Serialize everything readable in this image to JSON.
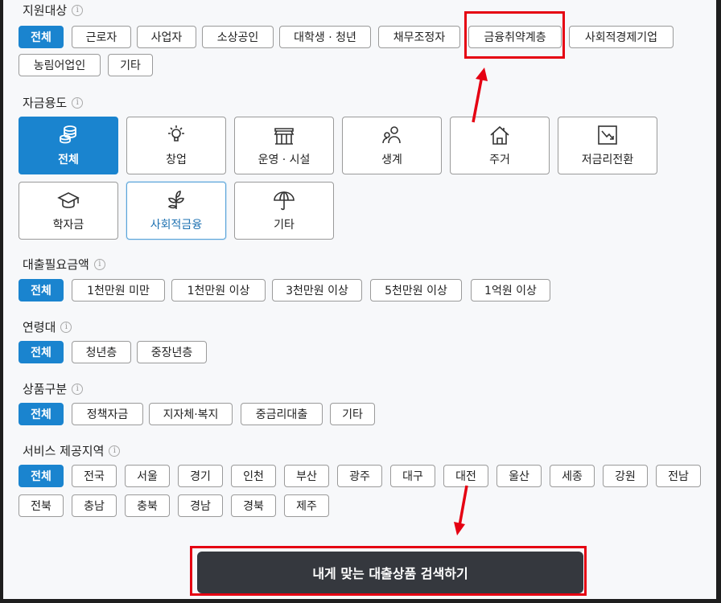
{
  "target_section": {
    "title": "지원대상",
    "row1": [
      "전체",
      "근로자",
      "사업자",
      "소상공인",
      "대학생 · 청년",
      "채무조정자",
      "금융취약계층",
      "사회적경제기업"
    ],
    "row2": [
      "농림어업인",
      "기타"
    ]
  },
  "purpose_section": {
    "title": "자금용도",
    "tiles": [
      {
        "label": "전체",
        "icon": "coins-icon"
      },
      {
        "label": "창업",
        "icon": "lightbulb-icon"
      },
      {
        "label": "운영 · 시설",
        "icon": "store-icon"
      },
      {
        "label": "생계",
        "icon": "people-icon"
      },
      {
        "label": "주거",
        "icon": "house-icon"
      },
      {
        "label": "저금리전환",
        "icon": "chart-down-icon"
      },
      {
        "label": "학자금",
        "icon": "graduation-cap-icon"
      },
      {
        "label": "사회적금융",
        "icon": "sprout-icon"
      },
      {
        "label": "기타",
        "icon": "umbrella-icon"
      }
    ]
  },
  "amount_section": {
    "title": "대출필요금액",
    "options": [
      "전체",
      "1천만원 미만",
      "1천만원 이상",
      "3천만원 이상",
      "5천만원 이상",
      "1억원 이상"
    ]
  },
  "age_section": {
    "title": "연령대",
    "options": [
      "전체",
      "청년층",
      "중장년층"
    ]
  },
  "product_section": {
    "title": "상품구분",
    "options": [
      "전체",
      "정책자금",
      "지자체·복지",
      "중금리대출",
      "기타"
    ]
  },
  "region_section": {
    "title": "서비스 제공지역",
    "row1": [
      "전체",
      "전국",
      "서울",
      "경기",
      "인천",
      "부산",
      "광주",
      "대구",
      "대전",
      "울산",
      "세종",
      "강원",
      "전남"
    ],
    "row2": [
      "전북",
      "충남",
      "충북",
      "경남",
      "경북",
      "제주"
    ]
  },
  "search_button": "내게 맞는 대출상품 검색하기",
  "colors": {
    "active": "#1a84cf",
    "highlight": "#e50012",
    "button": "#35383e"
  }
}
